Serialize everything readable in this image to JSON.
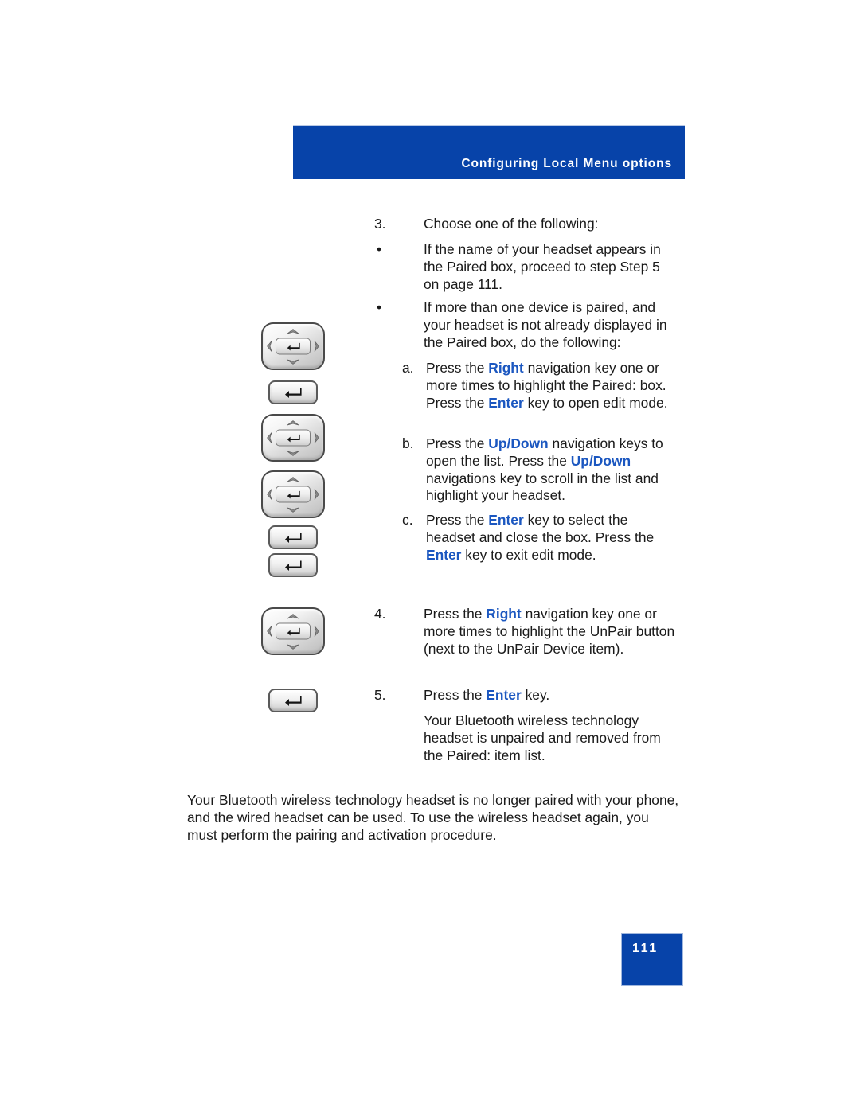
{
  "header": {
    "title": "Configuring Local Menu options",
    "banner_color": "#0743a9",
    "title_color": "#ffffff"
  },
  "keyword_color": "#1b57c0",
  "steps": [
    {
      "marker": "3.",
      "text_parts": [
        {
          "t": "Choose one of the following:"
        }
      ]
    }
  ],
  "bullets": [
    {
      "marker": "•",
      "text": "If the name of your headset appears in the Paired box, proceed to step Step 5 on page 111."
    },
    {
      "marker": "•",
      "text": "If more than one device is paired, and your headset is not already displayed in the Paired box, do the following:"
    }
  ],
  "sub_steps": [
    {
      "marker": "a.",
      "parts": [
        {
          "t": "Press the "
        },
        {
          "t": "Right",
          "kw": true
        },
        {
          "t": " navigation key one or more times to highlight the Paired: box. Press the "
        },
        {
          "t": "Enter",
          "kw": true
        },
        {
          "t": " key to open edit mode."
        }
      ]
    },
    {
      "marker": "b.",
      "parts": [
        {
          "t": "Press the "
        },
        {
          "t": "Up",
          "kw": true
        },
        {
          "t": "/",
          "kw": true
        },
        {
          "t": "Down",
          "kw": true
        },
        {
          "t": " navigation keys to open the list. Press the "
        },
        {
          "t": "Up",
          "kw": true
        },
        {
          "t": "/",
          "kw": true
        },
        {
          "t": "Down",
          "kw": true
        },
        {
          "t": " navigations key to scroll in the list and highlight your headset."
        }
      ]
    },
    {
      "marker": "c.",
      "parts": [
        {
          "t": "Press the "
        },
        {
          "t": "Enter",
          "kw": true
        },
        {
          "t": " key to select the headset and close the box. Press the "
        },
        {
          "t": "Enter",
          "kw": true
        },
        {
          "t": " key to exit edit mode."
        }
      ]
    }
  ],
  "step4": {
    "marker": "4.",
    "parts": [
      {
        "t": "Press the "
      },
      {
        "t": "Right",
        "kw": true
      },
      {
        "t": " navigation key one or more times to highlight the UnPair button (next to the UnPair Device item)."
      }
    ]
  },
  "step5": {
    "marker": "5.",
    "parts": [
      {
        "t": "Press the "
      },
      {
        "t": "Enter",
        "kw": true
      },
      {
        "t": " key."
      }
    ],
    "followup": "Your Bluetooth wireless technology headset is unpaired and removed from the Paired: item list."
  },
  "closing_paragraph": "Your Bluetooth wireless technology headset is no longer paired with your phone, and the wired headset can be used. To use the wireless headset again, you must perform the pairing and activation procedure.",
  "page_number": "111",
  "icons": [
    {
      "name": "navigation-cluster-icon",
      "label": "Navigation cluster key"
    },
    {
      "name": "enter-key-icon",
      "label": "Enter key"
    },
    {
      "name": "navigation-cluster-icon",
      "label": "Navigation cluster key"
    },
    {
      "name": "navigation-cluster-icon",
      "label": "Navigation cluster key"
    },
    {
      "name": "enter-key-icon",
      "label": "Enter key"
    },
    {
      "name": "enter-key-icon",
      "label": "Enter key"
    },
    {
      "name": "navigation-cluster-icon",
      "label": "Navigation cluster key"
    },
    {
      "name": "enter-key-icon",
      "label": "Enter key"
    }
  ]
}
